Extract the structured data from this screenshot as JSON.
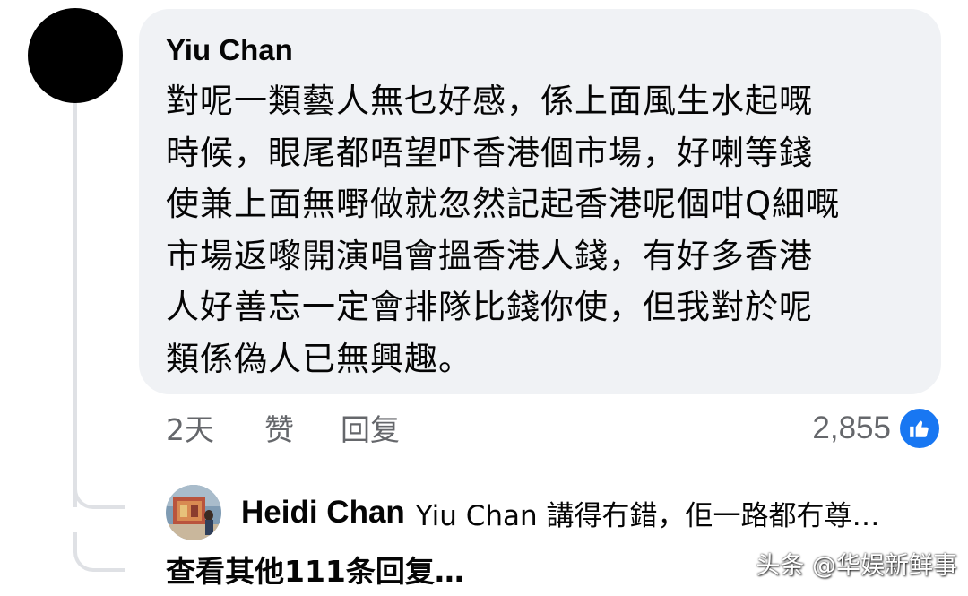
{
  "comment": {
    "author": "Yiu Chan",
    "lines": [
      "對呢一類藝人無乜好感，係上面風生水起嘅",
      "時候，眼尾都唔望吓香港個市場，好喇等錢",
      "使兼上面無嘢做就忽然記起香港呢個咁Q細嘅",
      "市場返嚟開演唱會搵香港人錢，有好多香港",
      "人好善忘一定會排隊比錢你使，但我對於呢",
      "類係偽人已無興趣。"
    ],
    "time": "2天",
    "like_label": "赞",
    "reply_label": "回复",
    "reaction_count": "2,855",
    "reaction_icon": "thumbs-up-icon",
    "colors": {
      "bubble": "#f0f2f5",
      "like_blue": "#1877f2",
      "meta_gray": "#65676b"
    }
  },
  "reply": {
    "author": "Heidi Chan",
    "preview": "Yiu Chan 講得冇錯，佢一路都冇尊…"
  },
  "view_more": "查看其他111条回复…",
  "watermark": "头条 @华娱新鲜事"
}
